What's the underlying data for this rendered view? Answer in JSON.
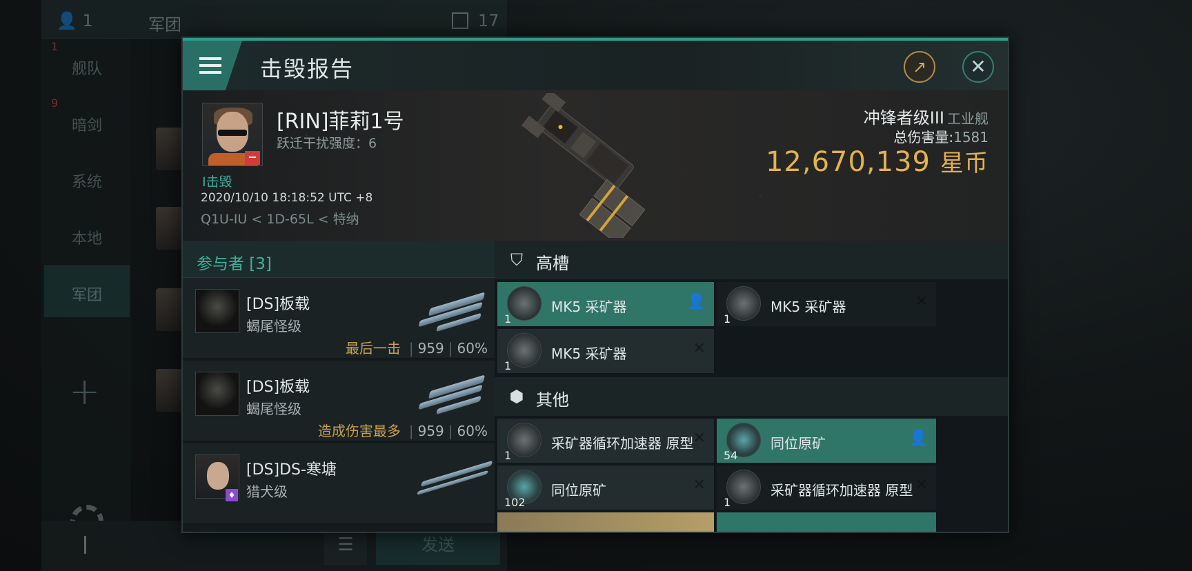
{
  "chat": {
    "member_count": "1",
    "channel_title": "军团",
    "message_count": "17",
    "sidebar": [
      {
        "label": "舰队",
        "badge": "1"
      },
      {
        "label": "暗剑",
        "badge": "9"
      },
      {
        "label": "系统",
        "badge": ""
      },
      {
        "label": "本地",
        "badge": ""
      },
      {
        "label": "军团",
        "badge": ""
      }
    ],
    "send_label": "发送"
  },
  "report": {
    "title": "击毁报告",
    "victim": {
      "name": "[RIN]菲莉1号",
      "warp_disruption": "跃迁干扰强度：6",
      "kills": "I击毁",
      "time": "2020/10/10 18:18:52 UTC +8",
      "location": "Q1U-IU < 1D-65L < 特纳"
    },
    "ship": {
      "class": "冲锋者级III",
      "type": "工业舰",
      "damage_label": "总伤害量:",
      "damage_value": "1581",
      "isk_value": "12,670,139",
      "isk_unit": "星币"
    },
    "participants": {
      "header": "参与者 [3]",
      "rows": [
        {
          "name": "[DS]板载",
          "ship": "蝎尾怪级",
          "tag": "最后一击",
          "damage": "959",
          "percent": "60%"
        },
        {
          "name": "[DS]板载",
          "ship": "蝎尾怪级",
          "tag": "造成伤害最多",
          "damage": "959",
          "percent": "60%"
        },
        {
          "name": "[DS]DS-寒塘",
          "ship": "猎犬级",
          "tag": "",
          "damage": "",
          "percent": ""
        }
      ]
    },
    "fittings": {
      "high_slots_label": "高槽",
      "other_label": "其他",
      "high_slots": [
        {
          "name": "MK5 采矿器",
          "qty": "1",
          "status": "dropped"
        },
        {
          "name": "MK5 采矿器",
          "qty": "1",
          "status": "destroyed"
        },
        {
          "name": "MK5 采矿器",
          "qty": "1",
          "status": "destroyed"
        }
      ],
      "other": [
        {
          "name": "采矿器循环加速器 原型",
          "qty": "1",
          "status": "destroyed"
        },
        {
          "name": "同位原矿",
          "qty": "54",
          "status": "dropped"
        },
        {
          "name": "同位原矿",
          "qty": "102",
          "status": "destroyed"
        },
        {
          "name": "采矿器循环加速器 原型",
          "qty": "1",
          "status": "destroyed"
        }
      ]
    }
  }
}
